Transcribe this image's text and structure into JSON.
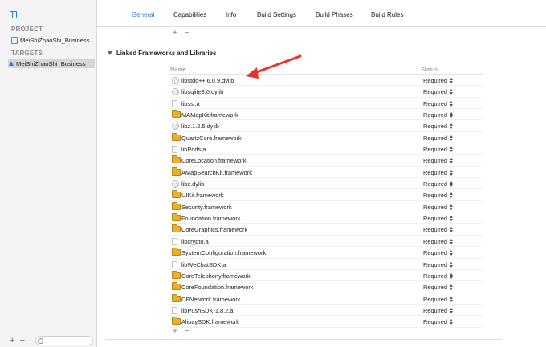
{
  "navigator": {
    "project_header": "PROJECT",
    "project_item": "MeiShiZhaoShi_Business",
    "targets_header": "TARGETS",
    "target_item": "MeiShiZhaoShi_Business",
    "add_label": "+",
    "remove_label": "−"
  },
  "tabs": [
    {
      "label": "General",
      "active": true
    },
    {
      "label": "Capabilities"
    },
    {
      "label": "Info"
    },
    {
      "label": "Build Settings"
    },
    {
      "label": "Build Phases"
    },
    {
      "label": "Build Rules"
    }
  ],
  "section": {
    "add_label": "+",
    "remove_label": "−",
    "title": "Linked Frameworks and Libraries",
    "col_name": "Name",
    "col_status": "Status"
  },
  "libraries": [
    {
      "name": "libstdc++.6.0.9.dylib",
      "status": "Required",
      "icon": "dylib-icon"
    },
    {
      "name": "libsqlite3.0.dylib",
      "status": "Required",
      "icon": "dylib-icon"
    },
    {
      "name": "libssl.a",
      "status": "Required",
      "icon": "file-icon"
    },
    {
      "name": "MAMapKit.framework",
      "status": "Required",
      "icon": "framework-icon"
    },
    {
      "name": "libz.1.2.5.dylib",
      "status": "Required",
      "icon": "dylib-icon"
    },
    {
      "name": "QuartzCore.framework",
      "status": "Required",
      "icon": "framework-icon"
    },
    {
      "name": "libPods.a",
      "status": "Required",
      "icon": "file-icon"
    },
    {
      "name": "CoreLocation.framework",
      "status": "Required",
      "icon": "framework-icon"
    },
    {
      "name": "AMapSearchKit.framework",
      "status": "Required",
      "icon": "framework-icon"
    },
    {
      "name": "libz.dylib",
      "status": "Required",
      "icon": "dylib-icon"
    },
    {
      "name": "UIKit.framework",
      "status": "Required",
      "icon": "framework-icon"
    },
    {
      "name": "Security.framework",
      "status": "Required",
      "icon": "framework-icon"
    },
    {
      "name": "Foundation.framework",
      "status": "Required",
      "icon": "framework-icon"
    },
    {
      "name": "CoreGraphics.framework",
      "status": "Required",
      "icon": "framework-icon"
    },
    {
      "name": "libcrypto.a",
      "status": "Required",
      "icon": "file-icon"
    },
    {
      "name": "SystemConfiguration.framework",
      "status": "Required",
      "icon": "framework-icon"
    },
    {
      "name": "libWeChatSDK.a",
      "status": "Required",
      "icon": "file-icon"
    },
    {
      "name": "CoreTelephony.framework",
      "status": "Required",
      "icon": "framework-icon"
    },
    {
      "name": "CoreFoundation.framework",
      "status": "Required",
      "icon": "framework-icon"
    },
    {
      "name": "CFNetwork.framework",
      "status": "Required",
      "icon": "framework-icon"
    },
    {
      "name": "libPushSDK-1.8.2.a",
      "status": "Required",
      "icon": "file-icon"
    },
    {
      "name": "AlipaySDK.framework",
      "status": "Required",
      "icon": "framework-icon"
    }
  ],
  "colors": {
    "accent": "#2a7de1",
    "annotation_arrow": "#e8322a",
    "framework_icon": "#e8b22c"
  }
}
